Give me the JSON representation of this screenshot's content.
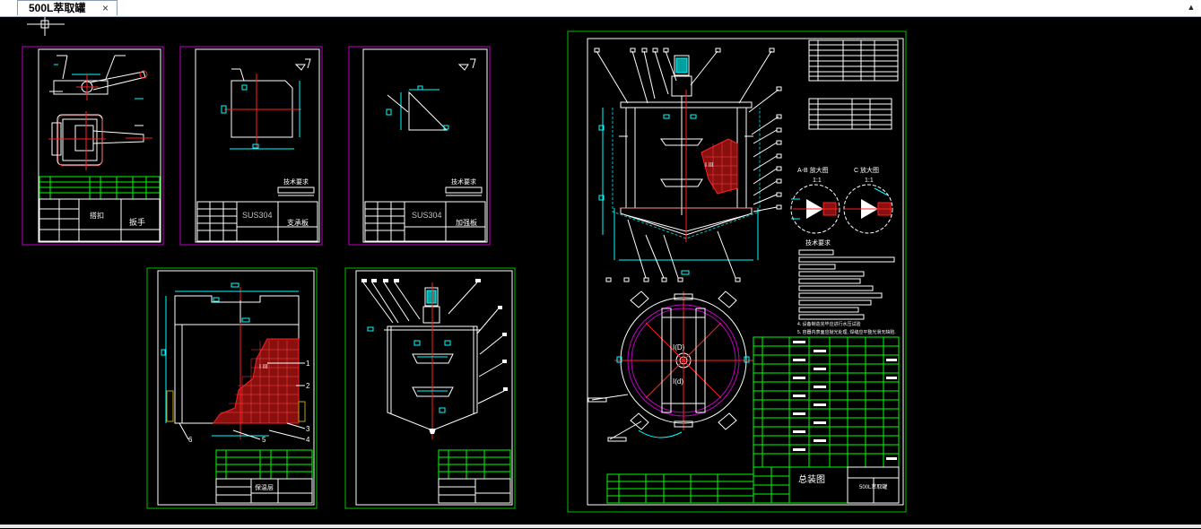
{
  "window": {
    "tab_title": "500L萃取罐",
    "close_glyph": "×",
    "scroll_glyph": "▲"
  },
  "drawings": {
    "sheet1": {
      "title_text": "搭扣",
      "part_name": "扳手",
      "tech_req": ""
    },
    "sheet2": {
      "material": "SUS304",
      "title_text": "支承板",
      "tech_req": "技术要求"
    },
    "sheet3": {
      "material": "SUS304",
      "title_text": "加强板",
      "tech_req": "技术要求"
    },
    "sheet4": {
      "title_text": "保温层",
      "callouts": [
        "1",
        "2",
        "3",
        "4",
        "5",
        "6"
      ]
    },
    "sheet6": {
      "title_text": "总装图",
      "drawing_no": "500L萃取罐",
      "section_a": "A-B 放大图",
      "section_b": "C 放大图",
      "scale_a": "1:1",
      "scale_b": "1:1",
      "tech_req": "技术要求",
      "view_label_1": "I(D)",
      "view_label_2": "I(d)"
    }
  },
  "colors": {
    "background": "#000000",
    "frame_magenta": "#c000c0",
    "frame_green": "#00c000",
    "line_white": "#ffffff",
    "line_red": "#ff2020",
    "line_cyan": "#00ffff",
    "line_green": "#00ff00",
    "line_yellow": "#ffff00",
    "hatch_red": "#d02020"
  }
}
